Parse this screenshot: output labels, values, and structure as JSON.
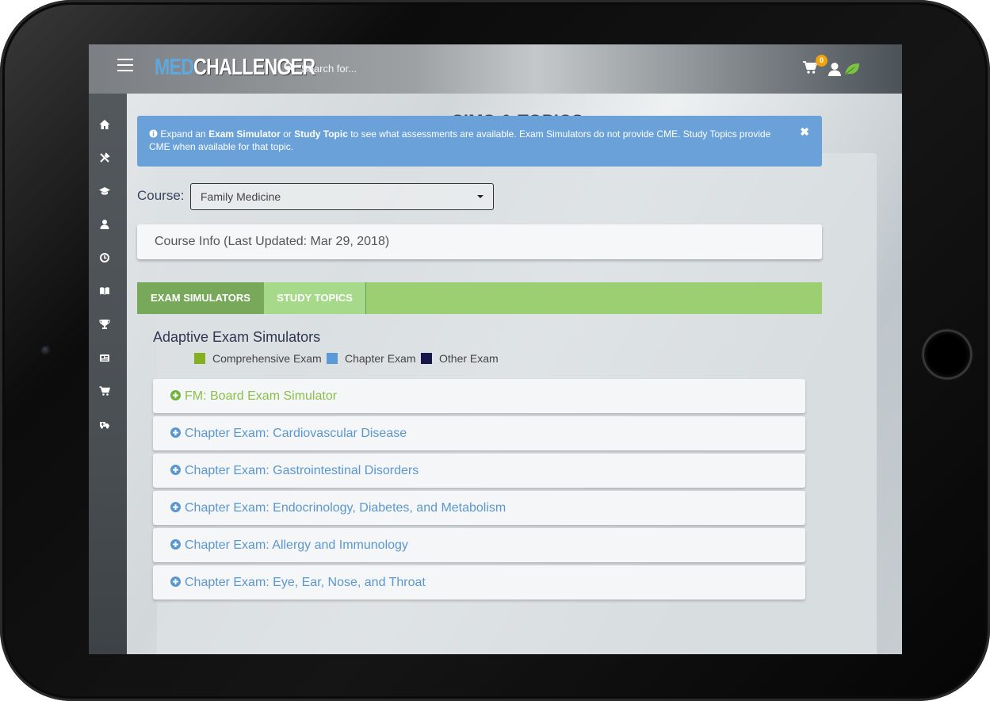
{
  "app": {
    "logo_med": "MED",
    "logo_challenger": "CHALLENGER"
  },
  "search": {
    "placeholder": "Search for..."
  },
  "cart": {
    "count": "0"
  },
  "sidebar": {
    "icons": [
      "home-icon",
      "tools-icon",
      "graduation-cap-icon",
      "user-md-icon",
      "history-icon",
      "book-icon",
      "trophy-icon",
      "newspaper-icon",
      "cart-icon",
      "ambulance-icon"
    ]
  },
  "page": {
    "title": "SIMS & TOPICS"
  },
  "alert": {
    "part1": "Expand an ",
    "bold1": "Exam Simulator",
    "part2": " or ",
    "bold2": "Study Topic",
    "part3": " to see what assessments are available. Exam Simulators do not provide CME. Study Topics provide CME when available for that topic.",
    "close": "✖"
  },
  "course": {
    "label": "Course:",
    "selected": "Family Medicine"
  },
  "course_info": "Course Info (Last Updated: Mar 29, 2018)",
  "tabs": [
    {
      "label": "EXAM SIMULATORS"
    },
    {
      "label": "STUDY TOPICS"
    }
  ],
  "section": {
    "title": "Adaptive Exam Simulators",
    "legend": [
      {
        "label": "Comprehensive Exam",
        "color": "#86b11f"
      },
      {
        "label": "Chapter Exam",
        "color": "#5b9ad6"
      },
      {
        "label": "Other Exam",
        "color": "#16174a"
      }
    ]
  },
  "exams": [
    {
      "label": "FM: Board Exam Simulator",
      "type": "comprehensive"
    },
    {
      "label": "Chapter Exam: Cardiovascular Disease",
      "type": "chapter"
    },
    {
      "label": "Chapter Exam: Gastrointestinal Disorders",
      "type": "chapter"
    },
    {
      "label": "Chapter Exam: Endocrinology, Diabetes, and Metabolism",
      "type": "chapter"
    },
    {
      "label": "Chapter Exam: Allergy and Immunology",
      "type": "chapter"
    },
    {
      "label": "Chapter Exam: Eye, Ear, Nose, and Throat",
      "type": "chapter"
    }
  ],
  "colors": {
    "accent_green": "#8bbf4b",
    "accent_blue": "#5b97cf",
    "alert_bg": "#6aa1d8",
    "tab_active": "#78a95a",
    "tab_bar": "#9ccf72"
  }
}
